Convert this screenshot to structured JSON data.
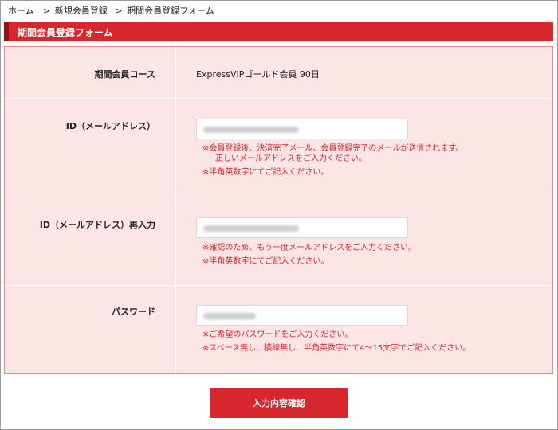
{
  "breadcrumb": {
    "items": [
      "ホーム",
      "新規会員登録",
      "期間会員登録フォーム"
    ],
    "separator": ">"
  },
  "page_title": "期間会員登録フォーム",
  "colors": {
    "accent": "#d7262d",
    "accent_dark": "#8b1217",
    "form_background": "#fbe5e5",
    "note_text": "#d22a2f"
  },
  "form": {
    "course": {
      "label": "期間会員コース",
      "value": "ExpressVIPゴールド会員 90日"
    },
    "email": {
      "label": "ID（メールアドレス）",
      "notes": [
        "※会員登録後、決済完了メール、会員登録完了のメールが送信されます。",
        "正しいメールアドレスをご入力ください。",
        "※半角英数字にてご記入ください。"
      ]
    },
    "email_confirm": {
      "label": "ID（メールアドレス）再入力",
      "notes": [
        "※確認のため、もう一度メールアドレスをご入力ください。",
        "※半角英数字にてご記入ください。"
      ]
    },
    "password": {
      "label": "パスワード",
      "notes": [
        "※ご希望のパスワードをご入力ください。",
        "※スペース無し、横線無し、半角英数字にて4〜15文字でご記入ください。"
      ]
    }
  },
  "submit_label": "入力内容確認"
}
